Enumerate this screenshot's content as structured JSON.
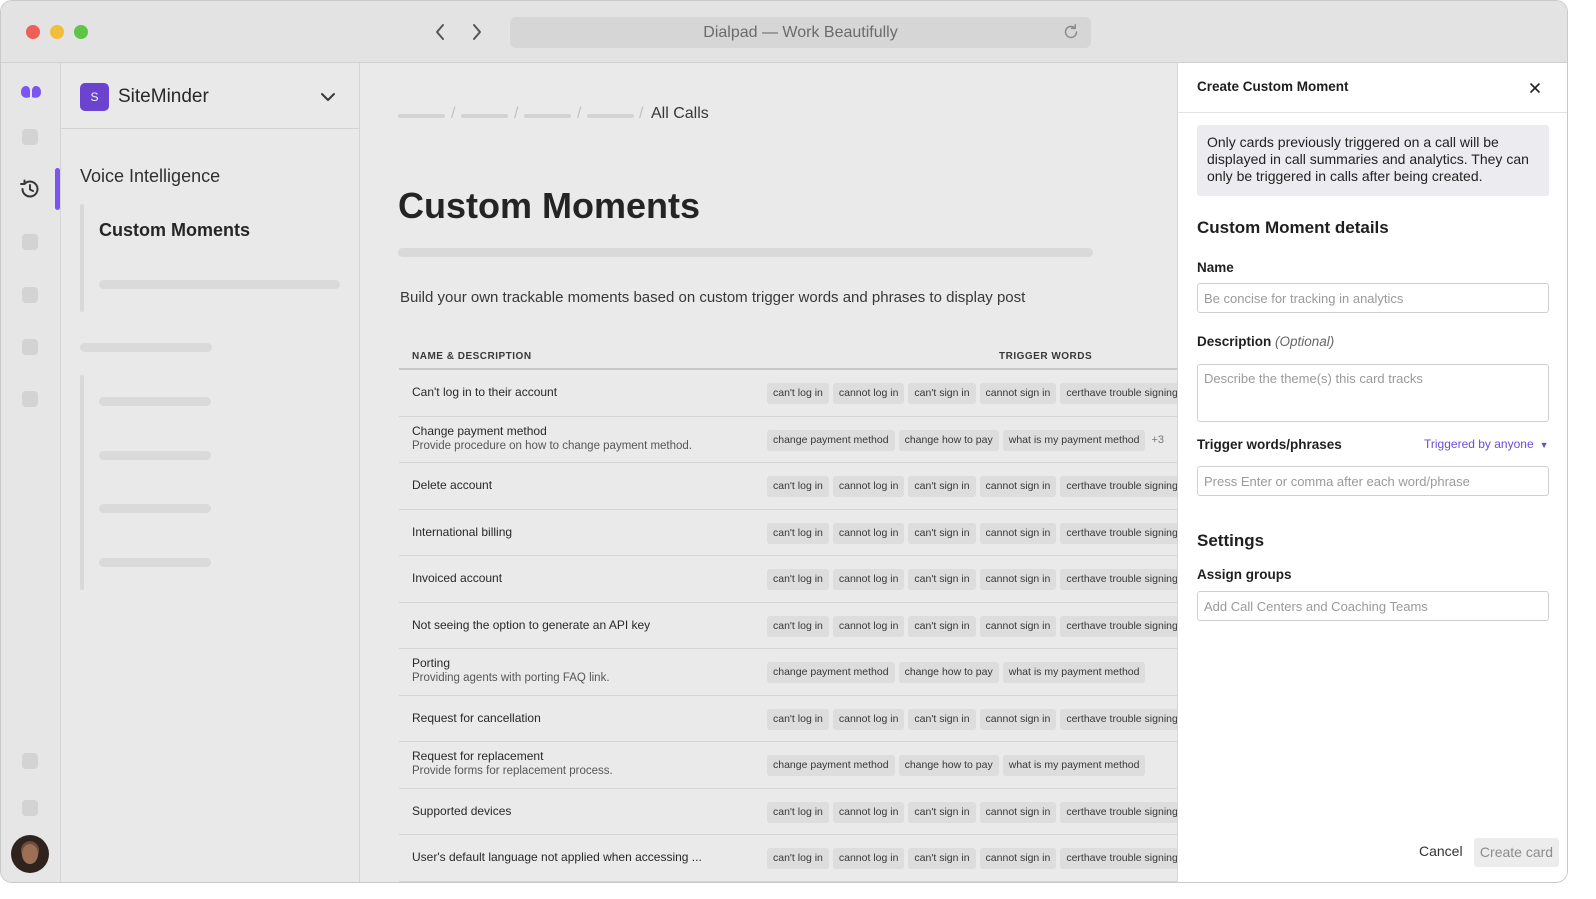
{
  "browser": {
    "url_title": "Dialpad — Work Beautifully"
  },
  "sidebar": {
    "org_initial": "S",
    "org_name": "SiteMinder",
    "section": "Voice Intelligence",
    "current_item": "Custom Moments"
  },
  "main": {
    "breadcrumb_current": "All Calls",
    "title": "Custom Moments",
    "description": "Build your own trackable moments based on custom trigger words and phrases to display post",
    "table": {
      "headers": [
        "NAME & DESCRIPTION",
        "TRIGGER WORDS"
      ],
      "rows": [
        {
          "name": "Can't log in to their account",
          "desc": "",
          "chips": [
            "can't log in",
            "cannot log in",
            "can't sign in",
            "cannot sign in",
            "certhave trouble signing"
          ],
          "more": ""
        },
        {
          "name": "Change payment method",
          "desc": "Provide procedure on how to change payment method.",
          "chips": [
            "change payment method",
            "change how to pay",
            "what is my payment method"
          ],
          "more": "+3"
        },
        {
          "name": "Delete account",
          "desc": "",
          "chips": [
            "can't log in",
            "cannot log in",
            "can't sign in",
            "cannot sign in",
            "certhave trouble signing"
          ],
          "more": ""
        },
        {
          "name": "International billing",
          "desc": "",
          "chips": [
            "can't log in",
            "cannot log in",
            "can't sign in",
            "cannot sign in",
            "certhave trouble signing"
          ],
          "more": ""
        },
        {
          "name": "Invoiced account",
          "desc": "",
          "chips": [
            "can't log in",
            "cannot log in",
            "can't sign in",
            "cannot sign in",
            "certhave trouble signing"
          ],
          "more": ""
        },
        {
          "name": "Not seeing the option to generate an API key",
          "desc": "",
          "chips": [
            "can't log in",
            "cannot log in",
            "can't sign in",
            "cannot sign in",
            "certhave trouble signing"
          ],
          "more": ""
        },
        {
          "name": "Porting",
          "desc": "Providing agents with porting FAQ link.",
          "chips": [
            "change payment method",
            "change how to pay",
            "what is my payment method"
          ],
          "more": ""
        },
        {
          "name": "Request for cancellation",
          "desc": "",
          "chips": [
            "can't log in",
            "cannot log in",
            "can't sign in",
            "cannot sign in",
            "certhave trouble signing"
          ],
          "more": ""
        },
        {
          "name": "Request for replacement",
          "desc": "Provide forms for replacement process.",
          "chips": [
            "change payment method",
            "change how to pay",
            "what is my payment method"
          ],
          "more": ""
        },
        {
          "name": "Supported devices",
          "desc": "",
          "chips": [
            "can't log in",
            "cannot log in",
            "can't sign in",
            "cannot sign in",
            "certhave trouble signing"
          ],
          "more": ""
        },
        {
          "name": "User's default language not applied when accessing ...",
          "desc": "",
          "chips": [
            "can't log in",
            "cannot log in",
            "can't sign in",
            "cannot sign in",
            "certhave trouble signing"
          ],
          "more": ""
        }
      ]
    }
  },
  "drawer": {
    "title": "Create Custom Moment",
    "notice": "Only cards previously triggered on a call will be displayed in call summaries and analytics. They can only be triggered in calls after being created.",
    "details_title": "Custom Moment details",
    "name_label": "Name",
    "name_placeholder": "Be concise for tracking in analytics",
    "description_label": "Description",
    "description_optional": "(Optional)",
    "description_placeholder": "Describe the theme(s) this card tracks",
    "trigger_label": "Trigger words/phrases",
    "trigger_by": "Triggered by anyone",
    "trigger_placeholder": "Press Enter or comma after each word/phrase",
    "settings_title": "Settings",
    "assign_label": "Assign groups",
    "assign_placeholder": "Add Call Centers and Coaching Teams",
    "cancel_label": "Cancel",
    "create_label": "Create card"
  },
  "colors": {
    "accent": "#7c52ff",
    "org_badge": "#6b3fd6",
    "link": "#6b4dd8"
  }
}
